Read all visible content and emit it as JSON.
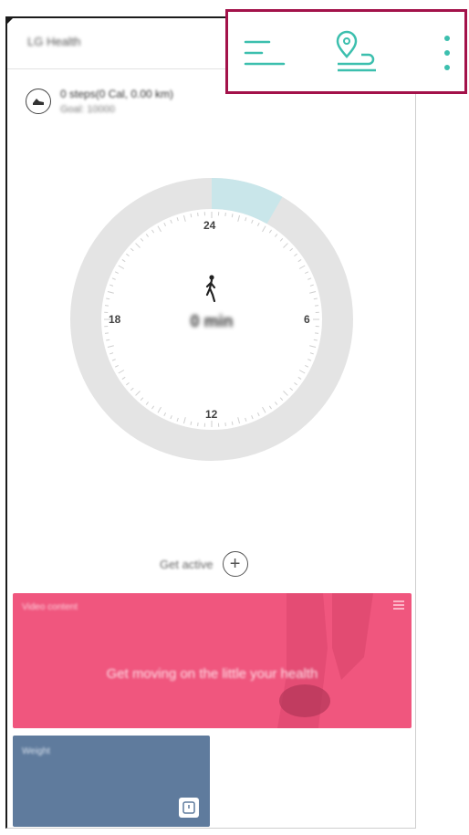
{
  "app": {
    "title": "LG Health"
  },
  "toolbar": {
    "items": [
      {
        "name": "menu-icon"
      },
      {
        "name": "location-route-icon"
      },
      {
        "name": "more-options-icon"
      }
    ]
  },
  "summary": {
    "title": "0 steps(0 Cal, 0.00 km)",
    "subtitle": "Goal: 10000",
    "icon": "shoe-icon"
  },
  "dial": {
    "hours": [
      "24",
      "6",
      "12",
      "18"
    ],
    "center_value": "0 min",
    "progress_start_hour": 0,
    "progress_end_hour": 2
  },
  "get_active": {
    "label": "Get active"
  },
  "promo_card": {
    "label": "Video content",
    "text": "Get moving on the little your health"
  },
  "weight_card": {
    "label": "Weight"
  },
  "colors": {
    "accent": "#3cbfae",
    "promo": "#f0567e",
    "weight": "#5f7b9d",
    "ring": "#e4e4e4",
    "progress": "#c9e6ea",
    "highlight": "#a3124a"
  }
}
